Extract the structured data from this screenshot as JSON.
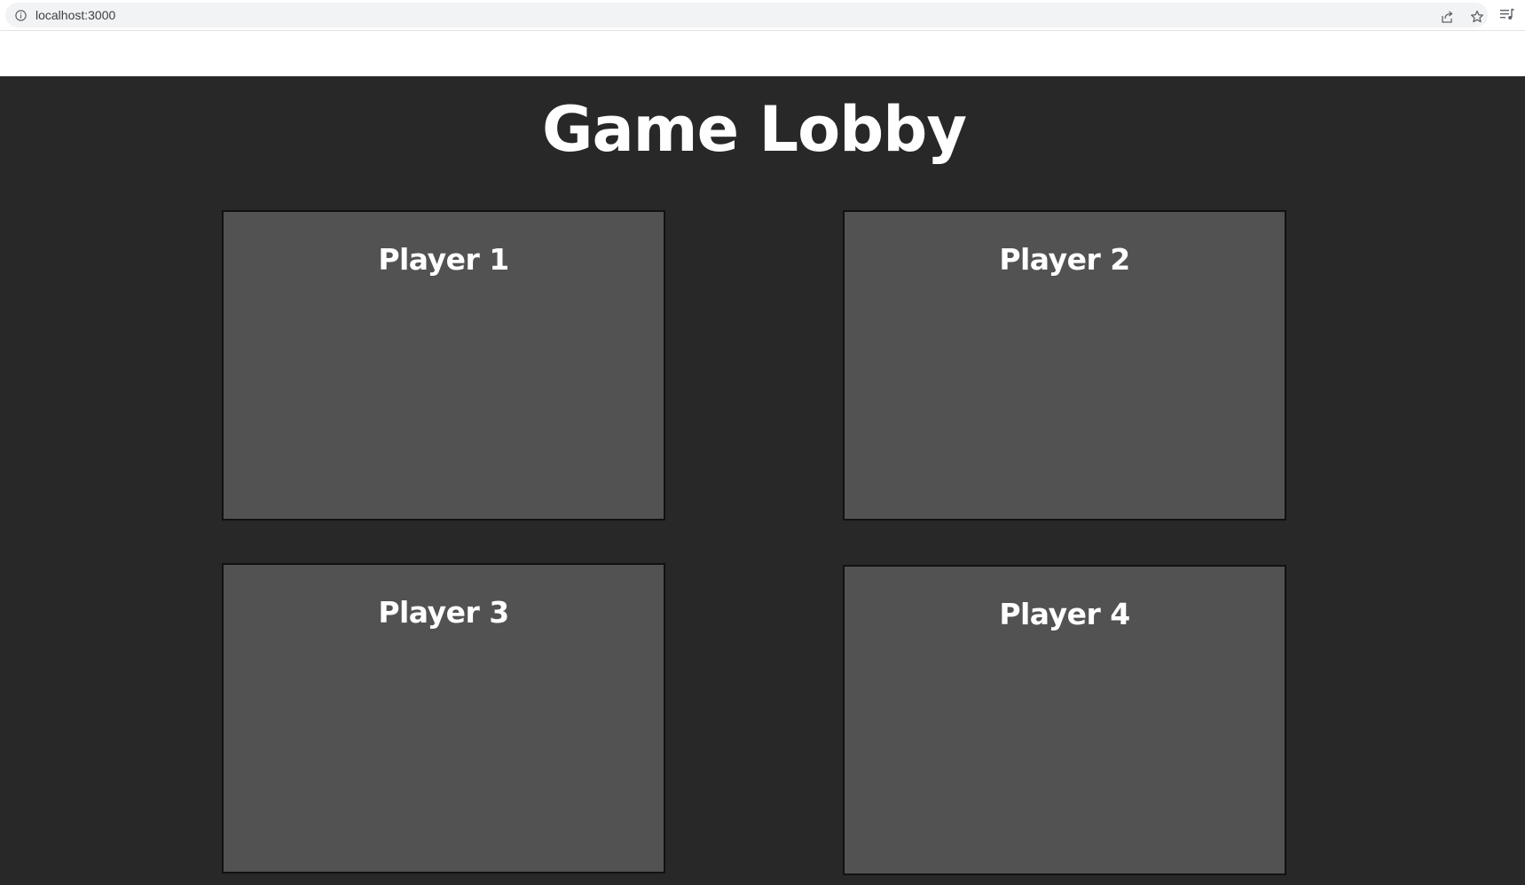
{
  "browser": {
    "url": "localhost:3000",
    "icons": [
      "info-icon",
      "share-icon",
      "star-icon",
      "media-control-icon"
    ]
  },
  "page": {
    "title": "Game Lobby",
    "background": "#282828",
    "card_color": "#525252"
  },
  "players": [
    {
      "label": "Player 1"
    },
    {
      "label": "Player 2"
    },
    {
      "label": "Player 3"
    },
    {
      "label": "Player 4"
    }
  ]
}
